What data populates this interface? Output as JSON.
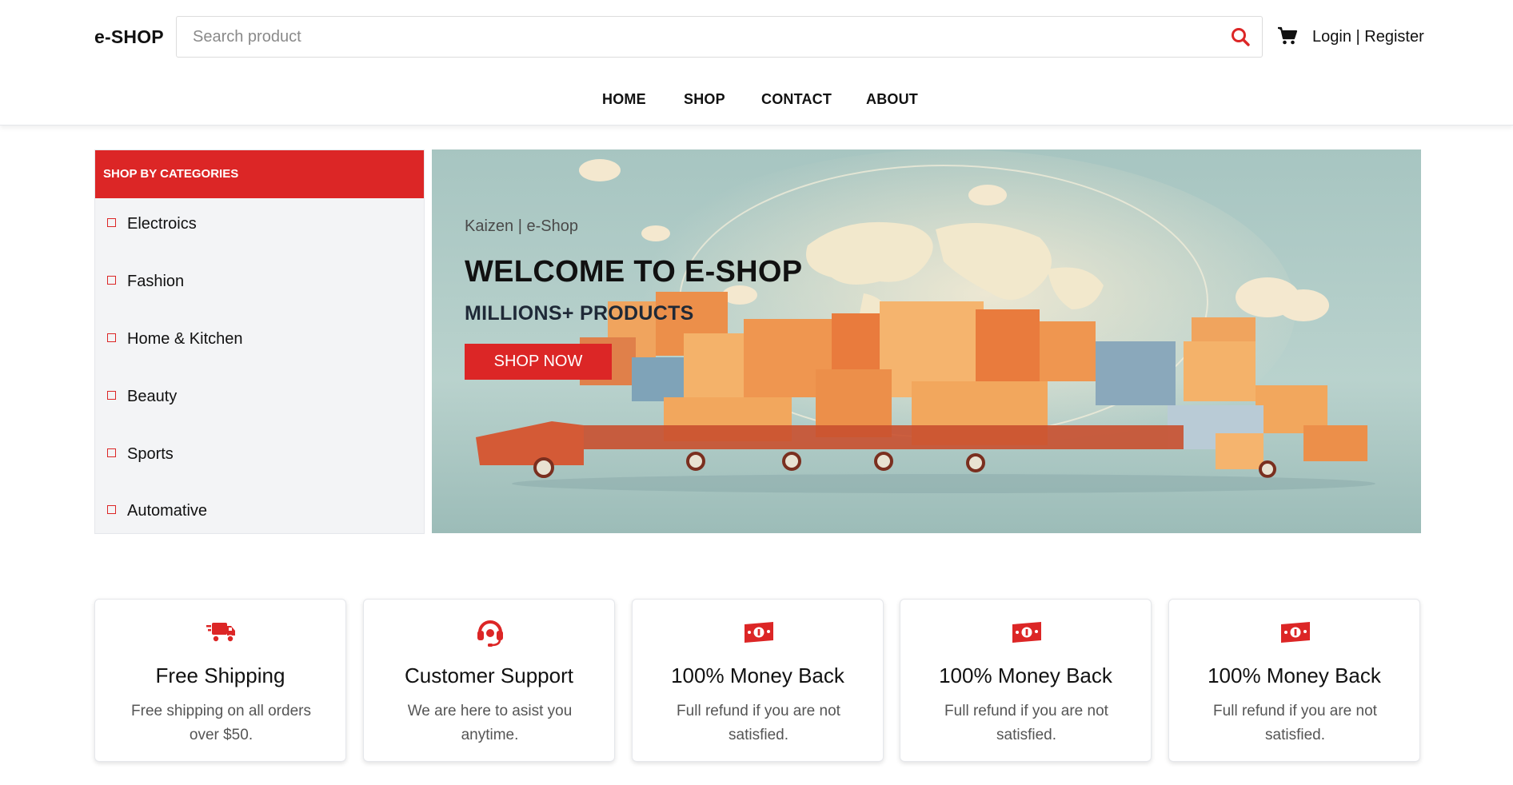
{
  "header": {
    "logo": "e-SHOP",
    "search_placeholder": "Search product",
    "search_icon": "search-icon",
    "cart_icon": "cart-icon",
    "login_label": "Login",
    "separator": " | ",
    "register_label": "Register"
  },
  "nav": {
    "items": [
      {
        "label": "HOME"
      },
      {
        "label": "SHOP"
      },
      {
        "label": "CONTACT"
      },
      {
        "label": "ABOUT"
      }
    ]
  },
  "categories": {
    "heading": "SHOP BY CATEGORIES",
    "items": [
      {
        "label": "Electroics"
      },
      {
        "label": "Fashion"
      },
      {
        "label": "Home & Kitchen"
      },
      {
        "label": "Beauty"
      },
      {
        "label": "Sports"
      },
      {
        "label": "Automative"
      }
    ]
  },
  "hero": {
    "subtitle": "Kaizen | e-Shop",
    "title": "WELCOME TO E-SHOP",
    "tagline": "MILLIONS+ PRODUCTS",
    "button": "SHOP NOW"
  },
  "features": [
    {
      "icon": "shipping-truck-icon",
      "title": "Free Shipping",
      "desc": "Free shipping on all orders over $50."
    },
    {
      "icon": "headset-icon",
      "title": "Customer Support",
      "desc": "We are here to asist you anytime."
    },
    {
      "icon": "money-icon",
      "title": "100% Money Back",
      "desc": "Full refund if you are not satisfied."
    },
    {
      "icon": "money-icon",
      "title": "100% Money Back",
      "desc": "Full refund if you are not satisfied."
    },
    {
      "icon": "money-icon",
      "title": "100% Money Back",
      "desc": "Full refund if you are not satisfied."
    }
  ],
  "colors": {
    "accent": "#dc2626",
    "sidebar_bg": "#f3f4f6",
    "hero_bg": "#a9c7c4",
    "text": "#111111"
  }
}
